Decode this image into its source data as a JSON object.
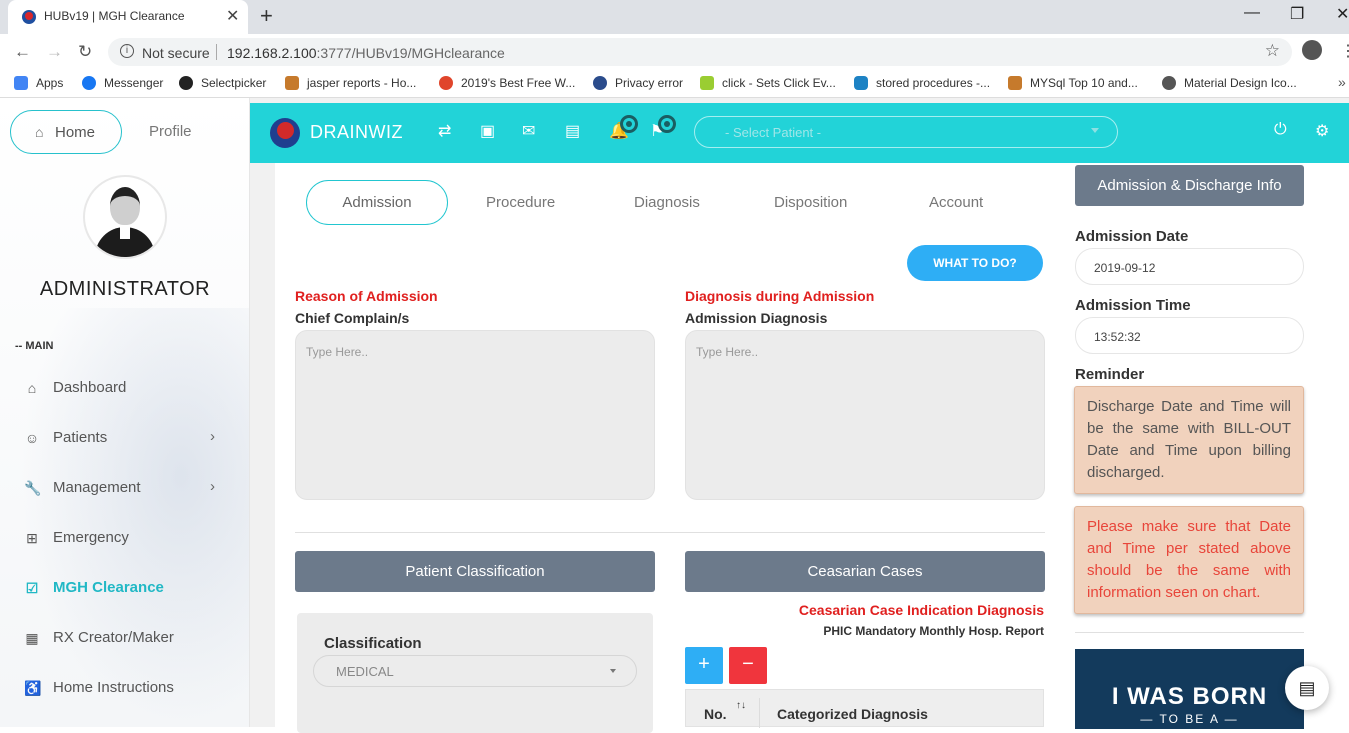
{
  "browser": {
    "tab_title": "HUBv19 | MGH Clearance",
    "tab_close": "✕",
    "new_tab": "+",
    "not_secure": "Not secure",
    "url_host": "192.168.2.100",
    "url_path": ":3777/HUBv19/MGHclearance",
    "bookmarks": [
      {
        "label": "Apps",
        "color": "#4285f4"
      },
      {
        "label": "Messenger",
        "color": "#1877f2"
      },
      {
        "label": "Selectpicker",
        "color": "#222222"
      },
      {
        "label": "jasper reports - Ho...",
        "color": "#c67a2c"
      },
      {
        "label": "2019's Best Free W...",
        "color": "#e0452b"
      },
      {
        "label": "Privacy error",
        "color": "#2b4c8c"
      },
      {
        "label": "click - Sets Click Ev...",
        "color": "#9acd32"
      },
      {
        "label": "stored procedures -...",
        "color": "#1d82c4"
      },
      {
        "label": "MYSql Top 10 and...",
        "color": "#c67a2c"
      },
      {
        "label": "Material Design Ico...",
        "color": "#555555"
      }
    ]
  },
  "sidebar": {
    "home": "Home",
    "profile": "Profile",
    "user": "ADMINISTRATOR",
    "menu_heading": "-- MAIN",
    "items": [
      {
        "label": "Dashboard",
        "icon": "⌂"
      },
      {
        "label": "Patients",
        "icon": "☺"
      },
      {
        "label": "Management",
        "icon": "🔧"
      },
      {
        "label": "Emergency",
        "icon": "⊞"
      },
      {
        "label": "MGH Clearance",
        "icon": "☑"
      },
      {
        "label": "RX Creator/Maker",
        "icon": "▦"
      },
      {
        "label": "Home Instructions",
        "icon": "♿"
      }
    ]
  },
  "topnav": {
    "brand": "DRAINWIZ",
    "patient_placeholder": "- Select Patient -"
  },
  "main": {
    "tabs": [
      "Admission",
      "Procedure",
      "Diagnosis",
      "Disposition",
      "Account"
    ],
    "what_to_do": "WHAT TO DO?",
    "reason_title": "Reason of Admission",
    "chief_label": "Chief Complain/s",
    "diag_title": "Diagnosis during Admission",
    "adm_diag_label": "Admission Diagnosis",
    "textarea_placeholder": "Type Here..",
    "patient_classification": "Patient Classification",
    "ceasarian_cases": "Ceasarian Cases",
    "classification_label": "Classification",
    "classification_value": "MEDICAL",
    "ces_title": "Ceasarian Case Indication Diagnosis",
    "ces_sub": "PHIC Mandatory Monthly Hosp. Report",
    "plus": "+",
    "minus": "−",
    "col_no": "No.",
    "col_diag": "Categorized  Diagnosis"
  },
  "right": {
    "header": "Admission & Discharge Info",
    "date_label": "Admission Date",
    "date_value": "2019-09-12",
    "time_label": "Admission Time",
    "time_value": "13:52:32",
    "reminder_label": "Reminder",
    "note1": "Discharge Date and Time will be the same with BILL-OUT Date and Time upon billing discharged.",
    "note2": "Please make sure that Date and Time per stated above should be the same with information seen on chart.",
    "banner_line1": "I WAS BORN",
    "banner_line2": "— TO BE A —"
  }
}
